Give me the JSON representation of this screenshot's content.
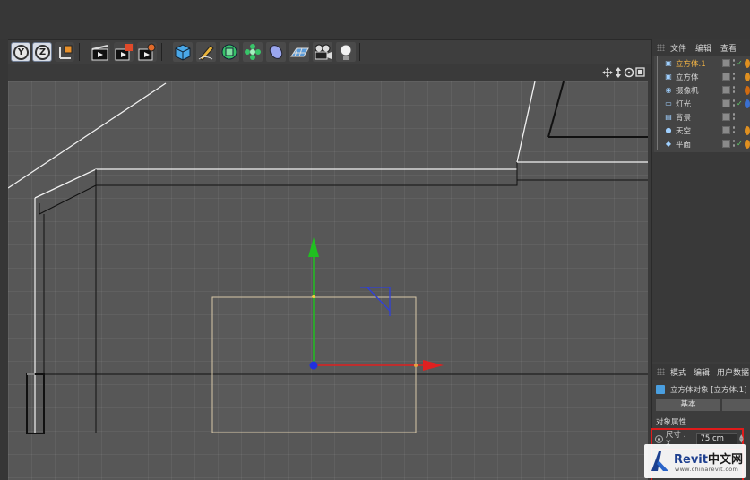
{
  "toolbar": {
    "axis_y_label": "Y",
    "axis_z_label": "Z",
    "icons": [
      "coordinate-system-icon",
      "render-view-icon",
      "render-picture-icon",
      "render-settings-icon",
      "cube-icon",
      "pen-icon",
      "subdivision-icon",
      "cloner-icon",
      "deformer-icon",
      "floor-icon",
      "camera-icon",
      "light-icon"
    ]
  },
  "viewport": {
    "nav_icons": [
      "move-view-icon",
      "zoom-view-icon",
      "rotate-view-icon",
      "maximize-view-icon"
    ]
  },
  "object_manager": {
    "menu": [
      "文件",
      "编辑",
      "查看"
    ],
    "objects": [
      {
        "label": "立方体.1",
        "icon": "cube-icon",
        "selected": true,
        "check": true,
        "tag_color": "#e09020"
      },
      {
        "label": "立方体",
        "icon": "cube-icon",
        "selected": false,
        "check": false,
        "tag_color": "#e09020"
      },
      {
        "label": "摄像机",
        "icon": "camera-icon",
        "selected": false,
        "check": false,
        "tag_color": "#d06a10"
      },
      {
        "label": "灯光",
        "icon": "light-icon",
        "selected": false,
        "check": true,
        "tag_color": "#3a70d0"
      },
      {
        "label": "背景",
        "icon": "background-icon",
        "selected": false,
        "check": false,
        "tag_color": ""
      },
      {
        "label": "天空",
        "icon": "sky-icon",
        "selected": false,
        "check": false,
        "tag_color": "#e09020"
      },
      {
        "label": "平面",
        "icon": "plane-icon",
        "selected": false,
        "check": true,
        "tag_color": "#e09020"
      }
    ]
  },
  "attribute_manager": {
    "menu": [
      "模式",
      "编辑",
      "用户数据"
    ],
    "title": "立方体对象 [立方体.1]",
    "tab_basic": "基本",
    "section": "对象属性",
    "size_label": "尺寸 . X",
    "size_value": "75 cm"
  },
  "watermark": {
    "title_brand": "Revit",
    "title_cn": "中文网",
    "url": "www.chinarevit.com"
  },
  "colors": {
    "accent_selected": "#f5b544",
    "highlight_box": "#e01b1b",
    "axis_x": "#e02020",
    "axis_y": "#20c020",
    "axis_z": "#2030e0"
  }
}
